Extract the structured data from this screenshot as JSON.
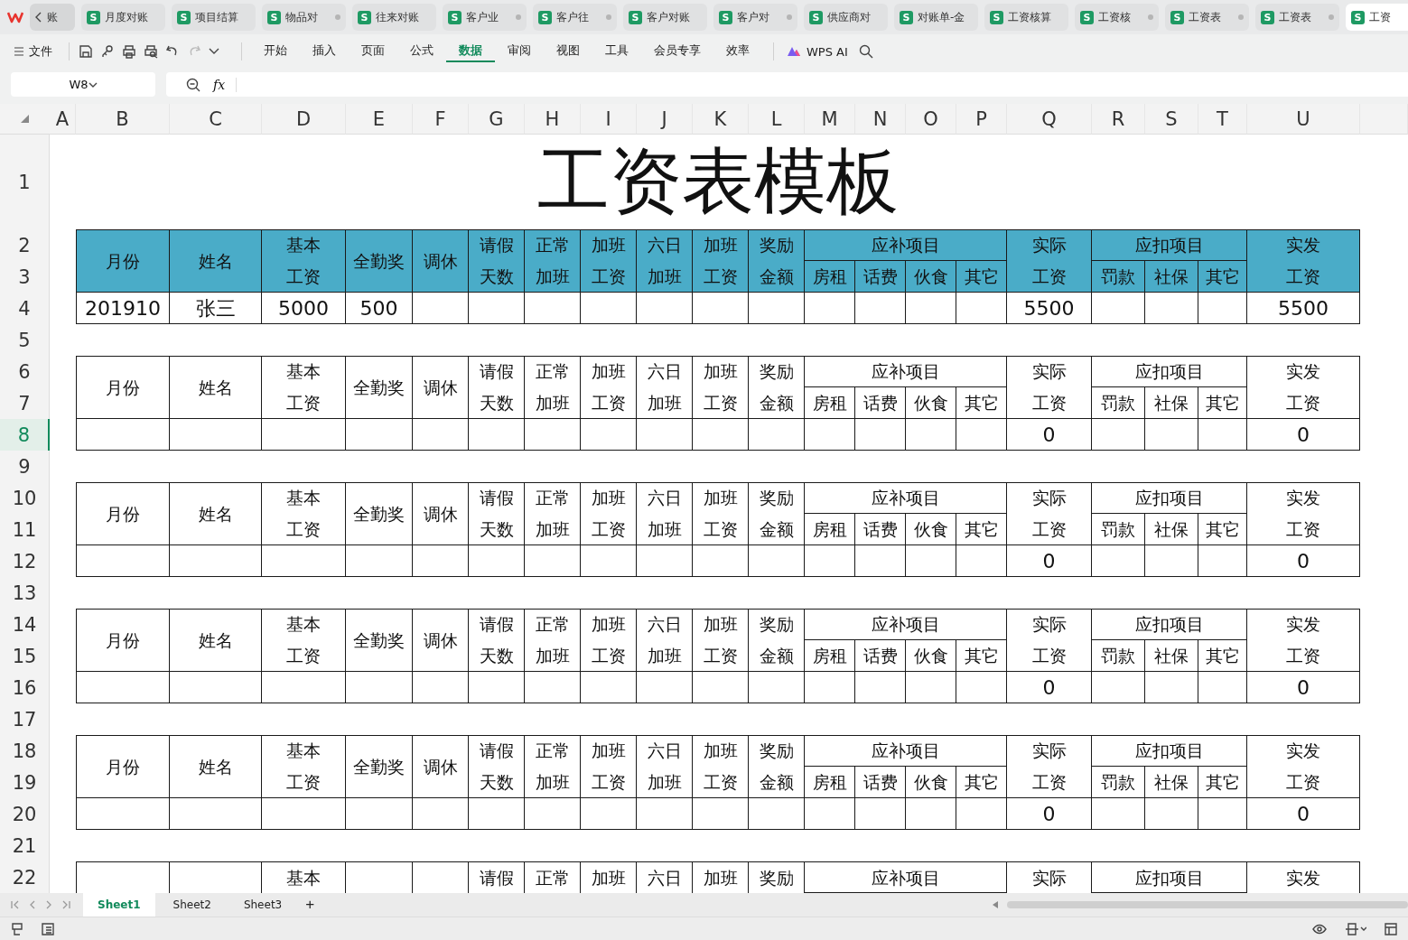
{
  "back_tab": {
    "label": "账"
  },
  "tabs": [
    {
      "badge": "S",
      "label": "月度对账",
      "modified": false,
      "selected": false
    },
    {
      "badge": "S",
      "label": "项目结算",
      "modified": false,
      "selected": false
    },
    {
      "badge": "S",
      "label": "物品对",
      "modified": true,
      "selected": false
    },
    {
      "badge": "S",
      "label": "往来对账",
      "modified": false,
      "selected": false
    },
    {
      "badge": "S",
      "label": "客户业",
      "modified": true,
      "selected": false
    },
    {
      "badge": "S",
      "label": "客户往",
      "modified": true,
      "selected": false
    },
    {
      "badge": "S",
      "label": "客户对账",
      "modified": false,
      "selected": false
    },
    {
      "badge": "S",
      "label": "客户对",
      "modified": true,
      "selected": false
    },
    {
      "badge": "S",
      "label": "供应商对",
      "modified": false,
      "selected": false
    },
    {
      "badge": "S",
      "label": "对账单-金",
      "modified": false,
      "selected": false
    },
    {
      "badge": "S",
      "label": "工资核算",
      "modified": false,
      "selected": false
    },
    {
      "badge": "S",
      "label": "工资核",
      "modified": true,
      "selected": false
    },
    {
      "badge": "S",
      "label": "工资表",
      "modified": true,
      "selected": false
    },
    {
      "badge": "S",
      "label": "工资表",
      "modified": true,
      "selected": false
    },
    {
      "badge": "S",
      "label": "工资",
      "modified": false,
      "selected": true
    }
  ],
  "toolbar": {
    "file_menu": "文件",
    "menu": [
      {
        "label": "开始",
        "selected": false
      },
      {
        "label": "插入",
        "selected": false
      },
      {
        "label": "页面",
        "selected": false
      },
      {
        "label": "公式",
        "selected": false
      },
      {
        "label": "数据",
        "selected": true
      },
      {
        "label": "审阅",
        "selected": false
      },
      {
        "label": "视图",
        "selected": false
      },
      {
        "label": "工具",
        "selected": false
      },
      {
        "label": "会员专享",
        "selected": false
      },
      {
        "label": "效率",
        "selected": false
      }
    ],
    "ai_button": "WPS AI"
  },
  "formula_bar": {
    "name_box": "W8",
    "function_label": "fx"
  },
  "sheet": {
    "columns": [
      "A",
      "B",
      "C",
      "D",
      "E",
      "F",
      "G",
      "H",
      "I",
      "J",
      "K",
      "L",
      "M",
      "N",
      "O",
      "P",
      "Q",
      "R",
      "S",
      "T",
      "U"
    ],
    "rows": [
      {
        "label": "1",
        "selected": false
      },
      {
        "label": "2",
        "selected": false
      },
      {
        "label": "3",
        "selected": false
      },
      {
        "label": "4",
        "selected": false
      },
      {
        "label": "5",
        "selected": false
      },
      {
        "label": "6",
        "selected": false
      },
      {
        "label": "7",
        "selected": false
      },
      {
        "label": "8",
        "selected": true
      },
      {
        "label": "9",
        "selected": false
      },
      {
        "label": "10",
        "selected": false
      },
      {
        "label": "11",
        "selected": false
      },
      {
        "label": "12",
        "selected": false
      },
      {
        "label": "13",
        "selected": false
      },
      {
        "label": "14",
        "selected": false
      },
      {
        "label": "15",
        "selected": false
      },
      {
        "label": "16",
        "selected": false
      },
      {
        "label": "17",
        "selected": false
      },
      {
        "label": "18",
        "selected": false
      },
      {
        "label": "19",
        "selected": false
      },
      {
        "label": "20",
        "selected": false
      },
      {
        "label": "21",
        "selected": false
      },
      {
        "label": "22",
        "selected": false
      }
    ],
    "title": "工资表模板",
    "blocks": [
      {
        "filled": true,
        "partial": false,
        "headers": [
          {
            "text": "月份"
          },
          {
            "text": "姓名"
          },
          {
            "text": "基本工资"
          },
          {
            "text": "全勤奖"
          },
          {
            "text": "调休"
          },
          {
            "text": "请假天数"
          },
          {
            "text": "正常加班"
          },
          {
            "text": "加班工资"
          },
          {
            "text": "六日加班"
          },
          {
            "text": "加班工资"
          },
          {
            "text": "奖励金额"
          },
          {
            "text": "应补项目",
            "children": [
              "房租",
              "话费",
              "伙食",
              "其它"
            ]
          },
          {
            "text": "实际工资"
          },
          {
            "text": "应扣项目",
            "children": [
              "罚款",
              "社保",
              "其它"
            ]
          },
          {
            "text": "实发工资"
          }
        ],
        "cells": [
          {
            "text": "201910"
          },
          {
            "text": "张三"
          },
          {
            "text": "5000"
          },
          {
            "text": "500"
          },
          {},
          {},
          {},
          {},
          {},
          {},
          {},
          {},
          {},
          {},
          {},
          {
            "text": "5500"
          },
          {},
          {},
          {},
          {
            "text": "5500"
          }
        ]
      },
      {
        "filled": false,
        "partial": false,
        "headers": [
          {
            "text": "月份"
          },
          {
            "text": "姓名"
          },
          {
            "text": "基本工资"
          },
          {
            "text": "全勤奖"
          },
          {
            "text": "调休"
          },
          {
            "text": "请假天数"
          },
          {
            "text": "正常加班"
          },
          {
            "text": "加班工资"
          },
          {
            "text": "六日加班"
          },
          {
            "text": "加班工资"
          },
          {
            "text": "奖励金额"
          },
          {
            "text": "应补项目",
            "children": [
              "房租",
              "话费",
              "伙食",
              "其它"
            ]
          },
          {
            "text": "实际工资"
          },
          {
            "text": "应扣项目",
            "children": [
              "罚款",
              "社保",
              "其它"
            ]
          },
          {
            "text": "实发工资"
          }
        ],
        "cells": [
          {},
          {},
          {},
          {},
          {},
          {},
          {},
          {},
          {},
          {},
          {},
          {},
          {},
          {},
          {},
          {
            "text": "0"
          },
          {},
          {},
          {},
          {
            "text": "0"
          }
        ]
      },
      {
        "filled": false,
        "partial": false,
        "headers": [
          {
            "text": "月份"
          },
          {
            "text": "姓名"
          },
          {
            "text": "基本工资"
          },
          {
            "text": "全勤奖"
          },
          {
            "text": "调休"
          },
          {
            "text": "请假天数"
          },
          {
            "text": "正常加班"
          },
          {
            "text": "加班工资"
          },
          {
            "text": "六日加班"
          },
          {
            "text": "加班工资"
          },
          {
            "text": "奖励金额"
          },
          {
            "text": "应补项目",
            "children": [
              "房租",
              "话费",
              "伙食",
              "其它"
            ]
          },
          {
            "text": "实际工资"
          },
          {
            "text": "应扣项目",
            "children": [
              "罚款",
              "社保",
              "其它"
            ]
          },
          {
            "text": "实发工资"
          }
        ],
        "cells": [
          {},
          {},
          {},
          {},
          {},
          {},
          {},
          {},
          {},
          {},
          {},
          {},
          {},
          {},
          {},
          {
            "text": "0"
          },
          {},
          {},
          {},
          {
            "text": "0"
          }
        ]
      },
      {
        "filled": false,
        "partial": false,
        "headers": [
          {
            "text": "月份"
          },
          {
            "text": "姓名"
          },
          {
            "text": "基本工资"
          },
          {
            "text": "全勤奖"
          },
          {
            "text": "调休"
          },
          {
            "text": "请假天数"
          },
          {
            "text": "正常加班"
          },
          {
            "text": "加班工资"
          },
          {
            "text": "六日加班"
          },
          {
            "text": "加班工资"
          },
          {
            "text": "奖励金额"
          },
          {
            "text": "应补项目",
            "children": [
              "房租",
              "话费",
              "伙食",
              "其它"
            ]
          },
          {
            "text": "实际工资"
          },
          {
            "text": "应扣项目",
            "children": [
              "罚款",
              "社保",
              "其它"
            ]
          },
          {
            "text": "实发工资"
          }
        ],
        "cells": [
          {},
          {},
          {},
          {},
          {},
          {},
          {},
          {},
          {},
          {},
          {},
          {},
          {},
          {},
          {},
          {
            "text": "0"
          },
          {},
          {},
          {},
          {
            "text": "0"
          }
        ]
      },
      {
        "filled": false,
        "partial": false,
        "headers": [
          {
            "text": "月份"
          },
          {
            "text": "姓名"
          },
          {
            "text": "基本工资"
          },
          {
            "text": "全勤奖"
          },
          {
            "text": "调休"
          },
          {
            "text": "请假天数"
          },
          {
            "text": "正常加班"
          },
          {
            "text": "加班工资"
          },
          {
            "text": "六日加班"
          },
          {
            "text": "加班工资"
          },
          {
            "text": "奖励金额"
          },
          {
            "text": "应补项目",
            "children": [
              "房租",
              "话费",
              "伙食",
              "其它"
            ]
          },
          {
            "text": "实际工资"
          },
          {
            "text": "应扣项目",
            "children": [
              "罚款",
              "社保",
              "其它"
            ]
          },
          {
            "text": "实发工资"
          }
        ],
        "cells": [
          {},
          {},
          {},
          {},
          {},
          {},
          {},
          {},
          {},
          {},
          {},
          {},
          {},
          {},
          {},
          {
            "text": "0"
          },
          {},
          {},
          {},
          {
            "text": "0"
          }
        ]
      },
      {
        "filled": false,
        "partial": true,
        "headers": [
          {
            "text": "基本"
          },
          {
            "text": "请假"
          },
          {
            "text": "正常"
          },
          {
            "text": "加班"
          },
          {
            "text": "六日"
          },
          {
            "text": "加班"
          },
          {
            "text": "奖励"
          },
          {
            "text": "应补项目"
          },
          {
            "text": "实际"
          },
          {
            "text": "应扣项目"
          },
          {
            "text": "实发"
          }
        ]
      }
    ]
  },
  "sheet_tabs": [
    {
      "label": "Sheet1",
      "selected": true
    },
    {
      "label": "Sheet2",
      "selected": false
    },
    {
      "label": "Sheet3",
      "selected": false
    }
  ],
  "add_sheet": "+"
}
